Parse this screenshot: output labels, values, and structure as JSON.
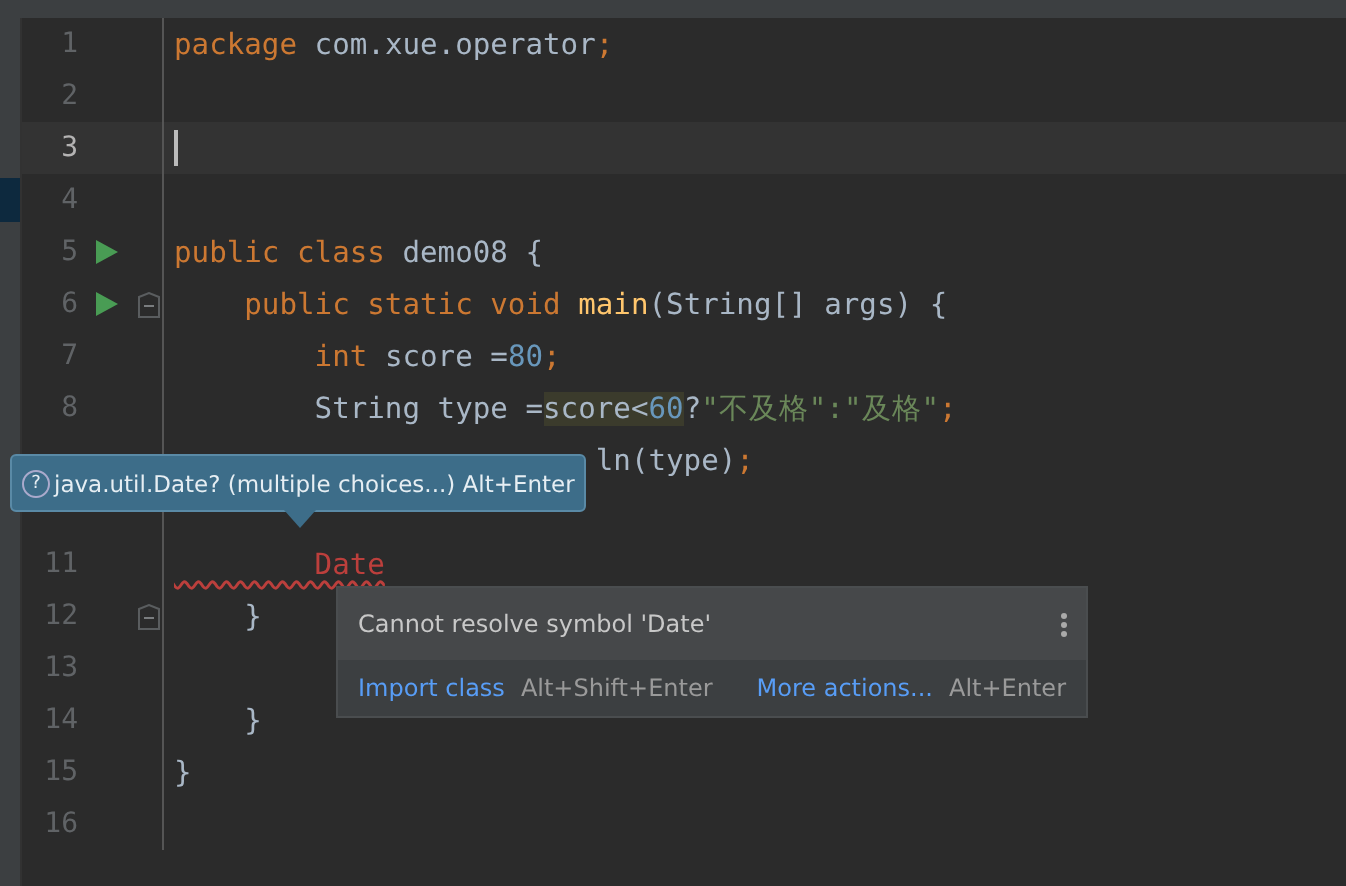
{
  "editor": {
    "lines": [
      {
        "number": "1",
        "current": false,
        "run": false,
        "fold": false,
        "tokens": [
          {
            "kind": "keyword",
            "text": "package"
          },
          {
            "kind": "plain",
            "text": " com.xue.operator"
          },
          {
            "kind": "keyword",
            "text": ";"
          }
        ]
      },
      {
        "number": "2",
        "current": false,
        "run": false,
        "fold": false
      },
      {
        "number": "3",
        "current": true,
        "run": false,
        "fold": false
      },
      {
        "number": "4",
        "current": false,
        "run": false,
        "fold": false
      },
      {
        "number": "5",
        "current": false,
        "run": true,
        "fold": false,
        "tokens": [
          {
            "kind": "keyword",
            "text": "public class"
          },
          {
            "kind": "plain",
            "text": " demo08 {"
          }
        ]
      },
      {
        "number": "6",
        "current": false,
        "run": true,
        "fold": true,
        "tokens": [
          {
            "kind": "keyword",
            "text": "    public static void "
          },
          {
            "kind": "method",
            "text": "main"
          },
          {
            "kind": "plain",
            "text": "(String[] args) {"
          }
        ]
      },
      {
        "number": "7",
        "current": false,
        "run": false,
        "fold": false,
        "tokens": [
          {
            "kind": "keyword",
            "text": "        int"
          },
          {
            "kind": "plain",
            "text": " score ="
          },
          {
            "kind": "number",
            "text": "80"
          },
          {
            "kind": "keyword",
            "text": ";"
          }
        ]
      },
      {
        "number": "8",
        "current": false,
        "run": false,
        "fold": false,
        "tokens": [
          {
            "kind": "plain",
            "text": "        String type ="
          },
          {
            "kind": "highlight",
            "text": "score<"
          },
          {
            "kind": "highlight-number",
            "text": "60"
          },
          {
            "kind": "plain",
            "text": "?"
          },
          {
            "kind": "string",
            "text": "\"不及格\":\"及格\""
          },
          {
            "kind": "keyword",
            "text": ";"
          }
        ]
      },
      {
        "current": false,
        "run": false,
        "fold": false,
        "tokens": [
          {
            "kind": "plain",
            "text": "                        ln(type)"
          },
          {
            "kind": "keyword",
            "text": ";"
          }
        ]
      },
      {
        "current": false,
        "run": false,
        "fold": false
      },
      {
        "number": "11",
        "current": false,
        "run": false,
        "fold": false,
        "tokens": [
          {
            "kind": "error",
            "text": "        Date"
          }
        ]
      },
      {
        "number": "12",
        "current": false,
        "run": false,
        "fold": true,
        "tokens": [
          {
            "kind": "plain",
            "text": "    }"
          }
        ]
      },
      {
        "number": "13",
        "current": false,
        "run": false,
        "fold": false
      },
      {
        "number": "14",
        "current": false,
        "run": false,
        "fold": false,
        "tokens": [
          {
            "kind": "plain",
            "text": "    }"
          }
        ]
      },
      {
        "number": "15",
        "current": false,
        "run": false,
        "fold": false,
        "tokens": [
          {
            "kind": "plain",
            "text": "}"
          }
        ]
      },
      {
        "number": "16",
        "current": false,
        "run": false,
        "fold": false
      }
    ]
  },
  "import_hint": {
    "icon": "?",
    "text": "java.util.Date? (multiple choices...) Alt+Enter"
  },
  "error_popup": {
    "message": "Cannot resolve symbol 'Date'",
    "actions": [
      {
        "label": "Import class",
        "shortcut": "Alt+Shift+Enter"
      },
      {
        "label": "More actions...",
        "shortcut": "Alt+Enter"
      }
    ]
  }
}
